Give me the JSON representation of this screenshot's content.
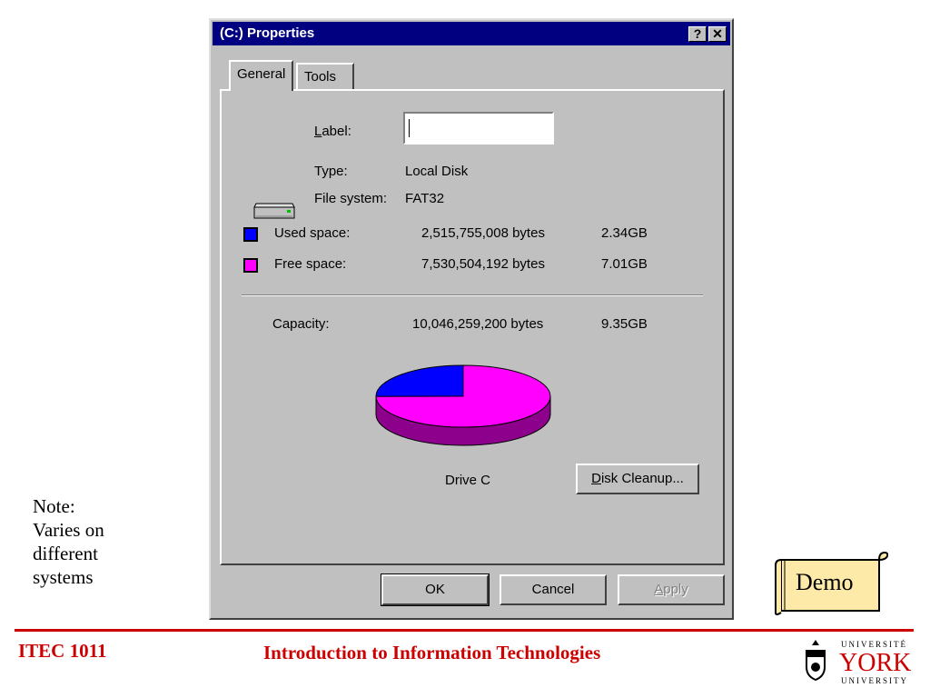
{
  "dialog": {
    "title": "(C:) Properties",
    "help_button": "?",
    "close_button": "✕",
    "tabs": [
      {
        "label": "General",
        "active": true
      },
      {
        "label": "Tools",
        "active": false
      }
    ],
    "label_field": {
      "label": "Label:",
      "value": ""
    },
    "type": {
      "label": "Type:",
      "value": "Local Disk"
    },
    "file_system": {
      "label": "File system:",
      "value": "FAT32"
    },
    "used_space": {
      "label": "Used space:",
      "bytes": "2,515,755,008 bytes",
      "size": "2.34GB",
      "color": "#0000ff"
    },
    "free_space": {
      "label": "Free space:",
      "bytes": "7,530,504,192 bytes",
      "size": "7.01GB",
      "color": "#ff00ff"
    },
    "capacity": {
      "label": "Capacity:",
      "bytes": "10,046,259,200 bytes",
      "size": "9.35GB"
    },
    "drive_label": "Drive C",
    "disk_cleanup_button": "Disk Cleanup...",
    "ok_button": "OK",
    "cancel_button": "Cancel",
    "apply_button": "Apply",
    "icons": {
      "drive": "hard-drive-icon",
      "help": "help-icon",
      "close": "close-icon"
    }
  },
  "chart_data": {
    "type": "pie",
    "slices": [
      {
        "name": "Used space",
        "value": 2515755008,
        "color": "#0000ff"
      },
      {
        "name": "Free space",
        "value": 7530504192,
        "color": "#ff00ff"
      }
    ]
  },
  "slide": {
    "note_lines": [
      "Note:",
      "Varies on",
      "different",
      "systems"
    ],
    "demo_label": "Demo",
    "course_code": "ITEC 1011",
    "course_title": "Introduction to Information Technologies",
    "logo": {
      "top": "UNIVERSITÉ",
      "name": "YORK",
      "bottom": "UNIVERSITY"
    },
    "accent_color": "#cc0000"
  }
}
